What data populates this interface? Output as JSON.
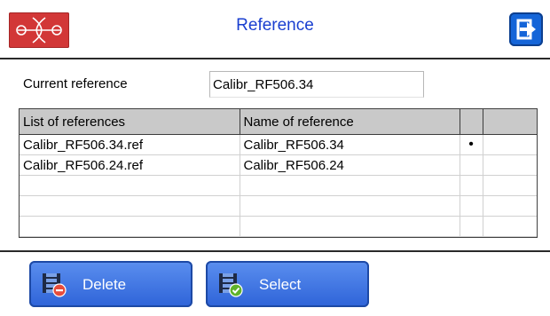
{
  "header": {
    "title": "Reference"
  },
  "reference": {
    "label": "Current reference",
    "value": "Calibr_RF506.34"
  },
  "table": {
    "columns": [
      "List of references",
      "Name of reference",
      "",
      ""
    ],
    "rows": [
      [
        "Calibr_RF506.34.ref",
        "Calibr_RF506.34",
        "•",
        ""
      ],
      [
        "Calibr_RF506.24.ref",
        "Calibr_RF506.24",
        "",
        ""
      ],
      [
        "",
        "",
        "",
        ""
      ],
      [
        "",
        "",
        "",
        ""
      ],
      [
        "",
        "",
        "",
        ""
      ]
    ]
  },
  "buttons": {
    "delete": "Delete",
    "select": "Select"
  }
}
